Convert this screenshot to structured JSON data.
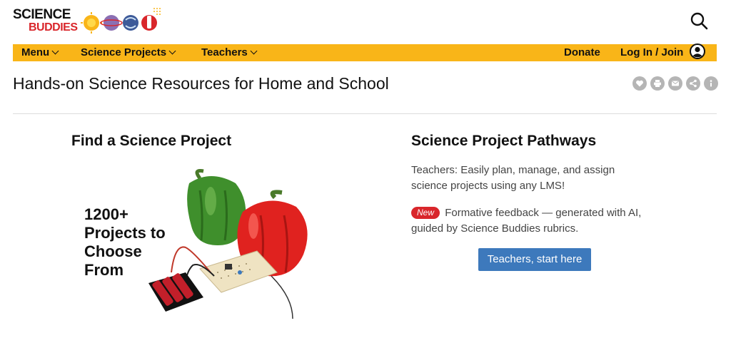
{
  "header": {
    "logo_top": "SCIENCE",
    "logo_bottom": "BUDDIES",
    "search_icon": "search-icon"
  },
  "nav": {
    "menu_label": "Menu",
    "projects_label": "Science Projects",
    "teachers_label": "Teachers",
    "donate_label": "Donate",
    "login_label": "Log In / Join"
  },
  "page": {
    "title": "Hands-on Science Resources for Home and School",
    "share_icons": [
      "heart-icon",
      "print-icon",
      "email-icon",
      "share-icon",
      "info-icon"
    ]
  },
  "left": {
    "heading": "Find a Science Project",
    "promo_line1": "1200+",
    "promo_line2": "Projects to",
    "promo_line3": "Choose",
    "promo_line4": "From"
  },
  "right": {
    "heading": "Science Project Pathways",
    "description": "Teachers: Easily plan, manage, and assign science projects using any LMS!",
    "new_badge": "New",
    "new_text": "Formative feedback — generated with AI, guided by Science Buddies rubrics.",
    "button_label": "Teachers, start here"
  },
  "colors": {
    "nav_bg": "#f9b518",
    "accent_red": "#d9262b",
    "button_blue": "#3d79bc"
  }
}
